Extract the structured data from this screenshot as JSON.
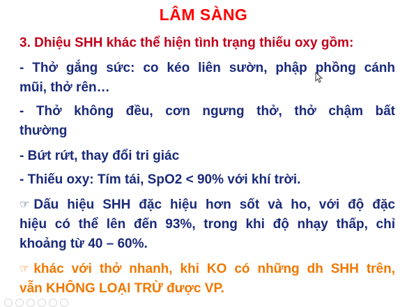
{
  "slide": {
    "title": "LÂM SÀNG",
    "heading": "3. Dhiệu SHH khác thể hiện tình trạng thiếu oxy gồm:",
    "lines": [
      "- Thở gắng sức: co kéo liên sườn, phập phồng cánh",
      "mũi, thở rên…",
      "- Thở không đều, cơn ngưng thở, thở chậm bất",
      "thường",
      "- Bứt rứt, thay đổi tri giác",
      "- Thiếu oxy: Tím tái, SpO2 < 90% với khí trời.",
      "Dấu hiệu SHH đặc hiệu hơn sốt và ho, với độ đặc",
      "hiệu có thể lên đến 93%, trong khi độ nhạy thấp, chỉ",
      "khoảng từ 40 – 60%.",
      "khác với thở nhanh, khi KO có những dh SHH trên,",
      "vẫn KHÔNG LOẠI TRỪ được VP."
    ],
    "pointer_icon": "pointing-hand-icon",
    "colors": {
      "title": "#ff0000",
      "heading": "#c0001a",
      "body": "#1a2a7a",
      "note": "#f07800"
    }
  }
}
